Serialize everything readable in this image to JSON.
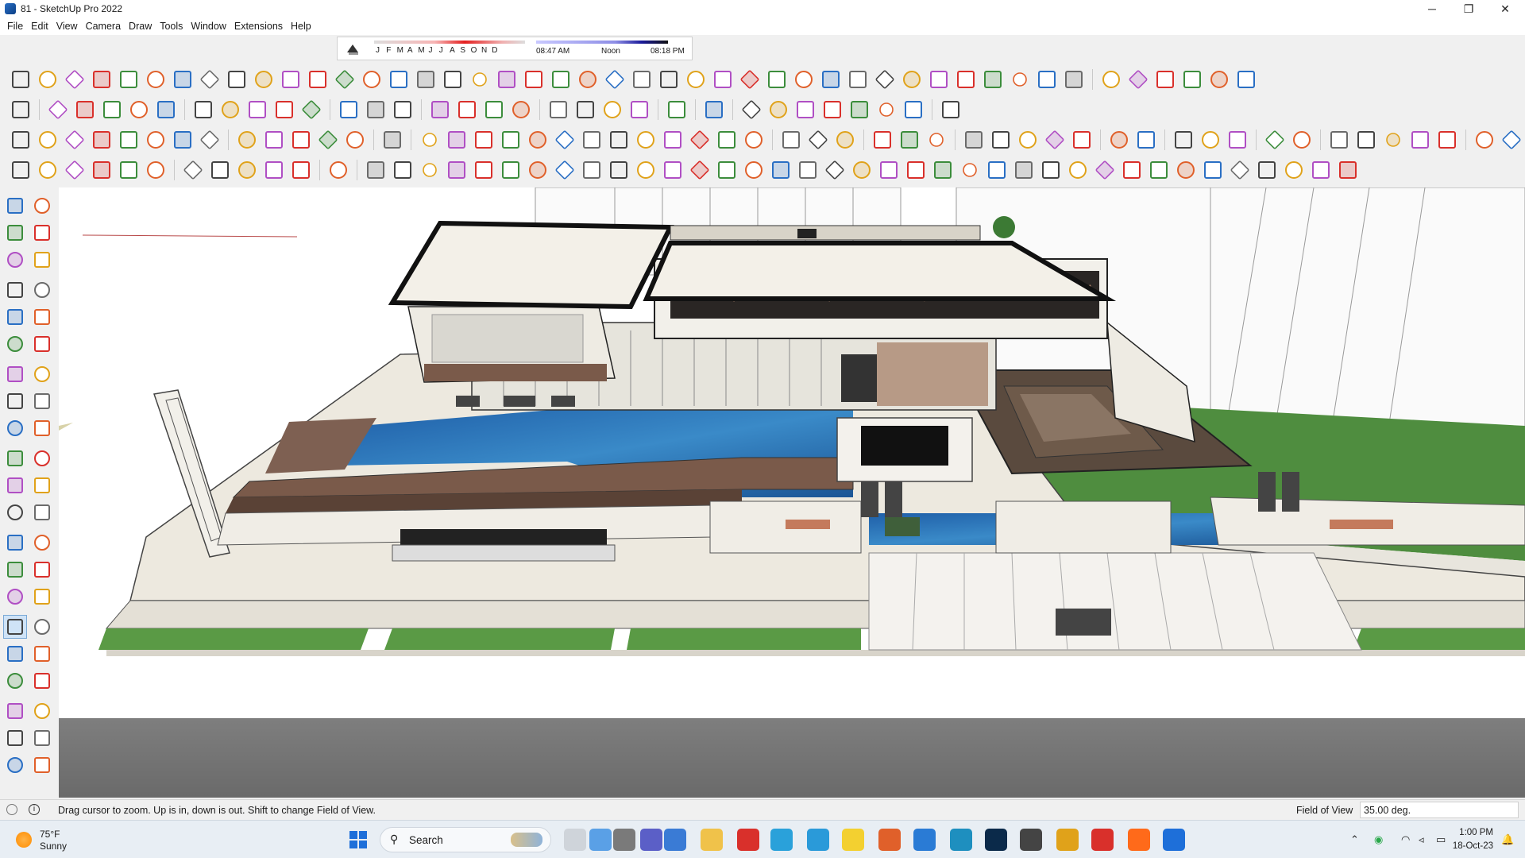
{
  "window": {
    "title": "81 - SketchUp Pro 2022",
    "minimize": "─",
    "maximize": "❐",
    "close": "✕"
  },
  "menu": [
    "File",
    "Edit",
    "View",
    "Camera",
    "Draw",
    "Tools",
    "Window",
    "Extensions",
    "Help"
  ],
  "shadow_settings": {
    "months": [
      "J",
      "F",
      "M",
      "A",
      "M",
      "J",
      "J",
      "A",
      "S",
      "O",
      "N",
      "D"
    ],
    "sunrise": "08:47 AM",
    "noon": "Noon",
    "sunset": "08:18 PM"
  },
  "status": {
    "hint": "Drag cursor to zoom.  Up is in, down is out. Shift to change Field of View.",
    "measure_label": "Field of View",
    "measure_value": "35.00 deg."
  },
  "taskbar": {
    "temperature": "75°F",
    "condition": "Sunny",
    "search_label": "Search",
    "time": "1:00 PM",
    "date": "18-Oct-23"
  },
  "colors": {
    "accent": "#1e6fd9",
    "red_tool": "#d9302b",
    "pool": "#2a72b8",
    "grass": "#4f8d3f",
    "deck": "#7a5a4a"
  }
}
